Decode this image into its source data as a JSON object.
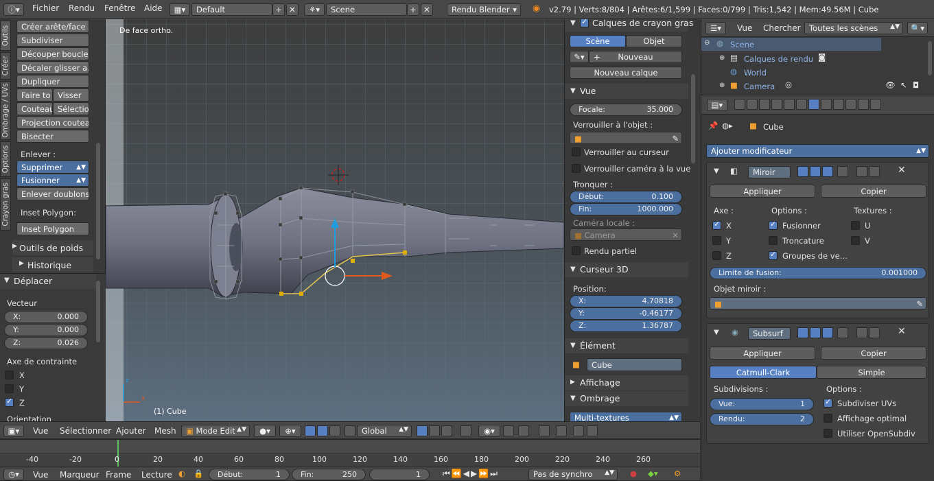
{
  "topbar": {
    "menus": [
      "Fichier",
      "Rendu",
      "Fenêtre",
      "Aide"
    ],
    "layout": "Default",
    "scene": "Scene",
    "engine": "Rendu Blender",
    "stats": "v2.79 | Verts:8/804 | Arêtes:6/1,599 | Faces:0/799 | Tris:1,542 | Mem:49.56M | Cube"
  },
  "left_tabs": [
    "Outils",
    "Créer",
    "Ombrage / UVs",
    "Options",
    "Crayon gras"
  ],
  "tools": {
    "create_edge": "Créer arête/face",
    "subdivide": "Subdiviser",
    "loopcut": "Découper boucle…",
    "edge_slide": "Décaler glisser a…",
    "duplicate": "Dupliquer",
    "rip": "Faire to",
    "screw": "Visser",
    "knife": "Couteau",
    "select": "Sélectio",
    "knife_project": "Projection couteau",
    "bisect": "Bisecter",
    "remove_label": "Enlever  :",
    "delete": "Supprimer",
    "merge": "Fusionner",
    "remove_doubles": "Enlever doublons",
    "inset_label": "Inset Polygon:",
    "inset": "Inset Polygon",
    "weight_tools": "Outils de poids",
    "history": "Historique"
  },
  "operator": {
    "title": "Déplacer",
    "vector_label": "Vecteur",
    "x_label": "X:",
    "x": "0.000",
    "y_label": "Y:",
    "y": "0.000",
    "z_label": "Z:",
    "z": "0.026",
    "constraint_label": "Axe de contrainte",
    "cx": "X",
    "cy": "Y",
    "cz": "Z",
    "orientation": "Orientation"
  },
  "viewport": {
    "view_name": "De face ortho.",
    "object_label": "(1) Cube",
    "axis_x": "x",
    "axis_z": "z"
  },
  "view3d_header": {
    "view": "Vue",
    "select": "Sélectionner",
    "add": "Ajouter",
    "mesh": "Mesh",
    "mode": "Mode Edit",
    "orientation": "Global"
  },
  "npanel": {
    "grease_pencil": "Calques de crayon gras",
    "scene_tab": "Scène",
    "object_tab": "Objet",
    "new": "Nouveau",
    "new_layer": "Nouveau calque",
    "view_title": "Vue",
    "focal_label": "Focale:",
    "focal": "35.000",
    "lock_object": "Verrouiller à l'objet  :",
    "lock_cursor": "Verrouiller au curseur",
    "lock_camera": "Verrouiller caméra à la vue",
    "clip_label": "Tronquer  :",
    "clip_start_label": "Début:",
    "clip_start": "0.100",
    "clip_end_label": "Fin:",
    "clip_end": "1000.000",
    "local_camera_label": "Caméra locale  :",
    "local_camera": "Camera",
    "partial_render": "Rendu partiel",
    "cursor_title": "Curseur 3D",
    "position_label": "Position:",
    "cx_label": "X:",
    "cx": "4.70818",
    "cy_label": "Y:",
    "cy": "-0.46177",
    "cz_label": "Z:",
    "cz": "1.36787",
    "item_title": "Élément",
    "item_name": "Cube",
    "display_title": "Affichage",
    "shading_title": "Ombrage",
    "shading_mode": "Multi-textures"
  },
  "outliner": {
    "view": "Vue",
    "search": "Chercher",
    "filter": "Toutes les scènes",
    "items": [
      "Scene",
      "Calques de rendu",
      "World",
      "Camera"
    ]
  },
  "properties": {
    "object": "Cube",
    "add_modifier": "Ajouter modificateur",
    "mirror": {
      "name": "Miroir",
      "apply": "Appliquer",
      "copy": "Copier",
      "axis_label": "Axe  :",
      "options_label": "Options  :",
      "textures_label": "Textures  :",
      "x": "X",
      "y": "Y",
      "z": "Z",
      "merge": "Fusionner",
      "clipping": "Troncature",
      "vgroups": "Groupes de ve…",
      "u": "U",
      "v": "V",
      "merge_limit_label": "Limite de fusion:",
      "merge_limit": "0.001000",
      "mirror_object_label": "Objet miroir  :"
    },
    "subsurf": {
      "name": "Subsurf",
      "apply": "Appliquer",
      "copy": "Copier",
      "catmull": "Catmull-Clark",
      "simple": "Simple",
      "subdivisions_label": "Subdivisions  :",
      "options_label": "Options  :",
      "view_label": "Vue:",
      "view": "1",
      "render_label": "Rendu:",
      "render": "2",
      "subdiv_uvs": "Subdiviser UVs",
      "optimal": "Affichage optimal",
      "opensubdiv": "Utiliser OpenSubdiv"
    }
  },
  "timeline": {
    "ticks": [
      "-40",
      "-20",
      "0",
      "20",
      "40",
      "60",
      "80",
      "100",
      "120",
      "140",
      "160",
      "180",
      "200",
      "220",
      "240",
      "260"
    ],
    "view": "Vue",
    "markers": "Marqueur",
    "frame": "Frame",
    "playback": "Lecture",
    "start_label": "Début:",
    "start": "1",
    "end_label": "Fin:",
    "end": "250",
    "current": "1",
    "sync": "Pas de synchro"
  },
  "colors": {
    "accent": "#5680c2",
    "selected": "#e0b000"
  }
}
